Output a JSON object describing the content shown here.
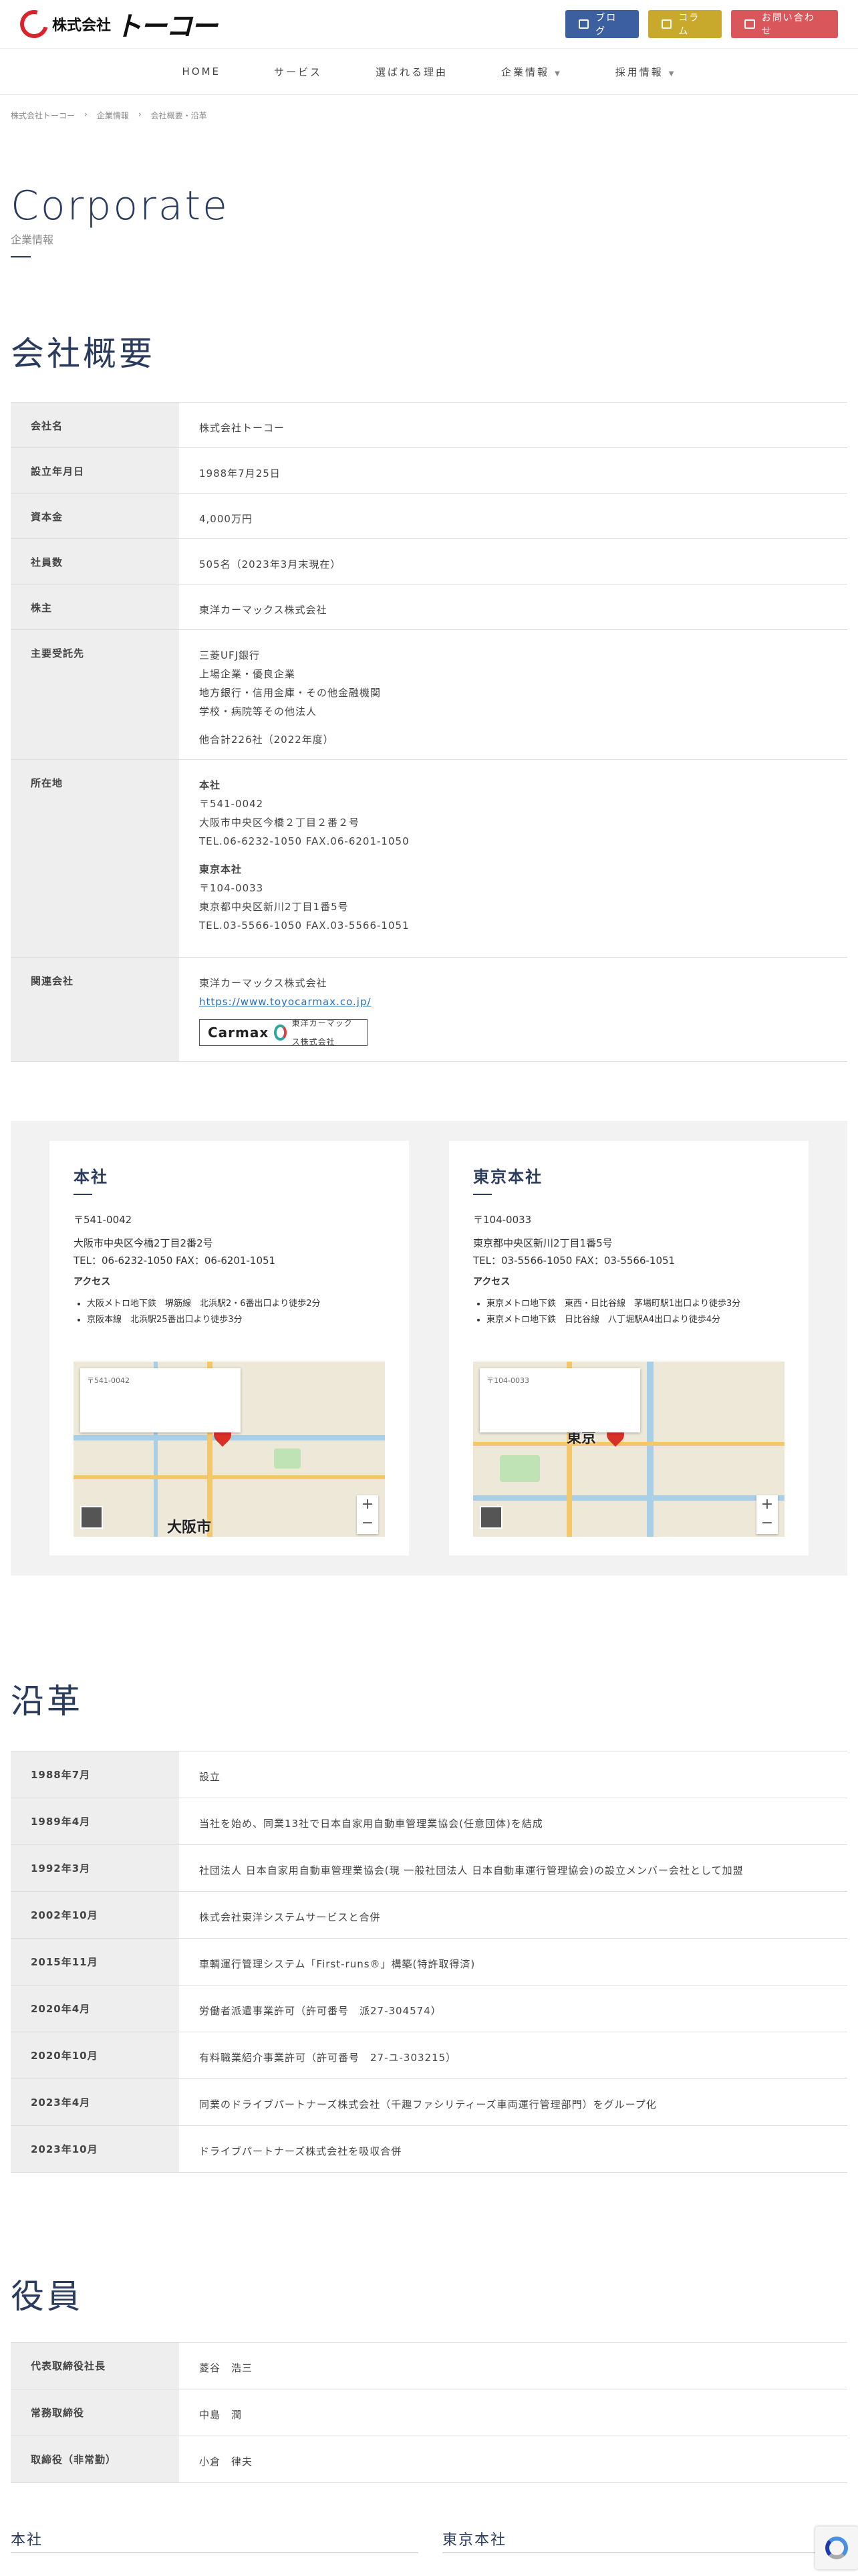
{
  "header": {
    "logo_small": "株式会社",
    "logo_big": "トーコー",
    "btn_blog": "ブログ",
    "btn_column": "コラム",
    "btn_contact": "お問い合わせ"
  },
  "nav": [
    "HOME",
    "サービス",
    "選ばれる理由",
    "企業情報",
    "採用情報"
  ],
  "breadcrumb": [
    "株式会社トーコー",
    "企業情報",
    "会社概要・沿革"
  ],
  "hero": {
    "en": "Corporate",
    "jp": "企業情報"
  },
  "overview": {
    "title": "会社概要",
    "rows": [
      {
        "th": "会社名",
        "td": [
          "株式会社トーコー"
        ]
      },
      {
        "th": "設立年月日",
        "td": [
          "1988年7月25日"
        ]
      },
      {
        "th": "資本金",
        "td": [
          "4,000万円"
        ]
      },
      {
        "th": "社員数",
        "td": [
          "505名（2023年3月末現在）"
        ]
      },
      {
        "th": "株主",
        "td": [
          "東洋カーマックス株式会社"
        ]
      },
      {
        "th": "主要受託先",
        "td": [
          "三菱UFJ銀行",
          "上場企業・優良企業",
          "地方銀行・信用金庫・その他金融機関",
          "学校・病院等その他法人",
          "",
          "他合計226社（2022年度）"
        ]
      },
      {
        "th": "所在地",
        "td": [
          "本社",
          "〒541-0042",
          "大阪市中央区今橋２丁目２番２号",
          "TEL.06-6232-1050 FAX.06-6201-1050",
          "",
          "東京本社",
          "〒104-0033",
          "東京都中央区新川2丁目1番5号",
          "TEL.03-5566-1050 FAX.03-5566-1051"
        ]
      },
      {
        "th": "関連会社",
        "td": [
          "東洋カーマックス株式会社",
          "https://www.toyocarmax.co.jp/"
        ]
      }
    ],
    "banner_logo": "Carmax",
    "banner_text": "東洋カーマックス株式会社"
  },
  "offices": [
    {
      "title": "本社",
      "zip": "〒541-0042",
      "addr": "大阪市中央区今橋2丁目2番2号",
      "tel": "TEL：06-6232-1050 FAX：06-6201-1051",
      "access_label": "アクセス",
      "access": [
        "大阪メトロ地下鉄　堺筋線　北浜駅2・6番出口より徒歩2分",
        "京阪本線　北浜駅25番出口より徒歩3分"
      ],
      "map_city": "大阪市",
      "map_zip": "〒541-0042"
    },
    {
      "title": "東京本社",
      "zip": "〒104-0033",
      "addr": "東京都中央区新川2丁目1番5号",
      "tel": "TEL：03-5566-1050 FAX：03-5566-1051",
      "access_label": "アクセス",
      "access": [
        "東京メトロ地下鉄　東西・日比谷線　茅場町駅1出口より徒歩3分",
        "東京メトロ地下鉄　日比谷線　八丁堀駅A4出口より徒歩4分"
      ],
      "map_city": "東京",
      "map_zip": "〒104-0033"
    }
  ],
  "history": {
    "title": "沿革",
    "rows": [
      {
        "th": "1988年7月",
        "td": "設立"
      },
      {
        "th": "1989年4月",
        "td": "当社を始め、同業13社で日本自家用自動車管理業協会(任意団体)を結成"
      },
      {
        "th": "1992年3月",
        "td": "社団法人 日本自家用自動車管理業協会(現 一般社団法人 日本自動車運行管理協会)の設立メンバー会社として加盟"
      },
      {
        "th": "2002年10月",
        "td": "株式会社東洋システムサービスと合併"
      },
      {
        "th": "2015年11月",
        "td": "車輌運行管理システム「First-runs®」構築(特許取得済)"
      },
      {
        "th": "2020年4月",
        "td": "労働者派遣事業許可（許可番号　派27-304574）"
      },
      {
        "th": "2020年10月",
        "td": "有料職業紹介事業許可（許可番号　27-ユ-303215）"
      },
      {
        "th": "2023年4月",
        "td": "同業のドライブパートナーズ株式会社（千趣ファシリティーズ車両運行管理部門）をグループ化"
      },
      {
        "th": "2023年10月",
        "td": "ドライブパートナーズ株式会社を吸収合併"
      }
    ]
  },
  "officers": {
    "title": "役員",
    "rows": [
      {
        "th": "代表取締役社長",
        "td": "菱谷　浩三"
      },
      {
        "th": "常務取締役",
        "td": "中島　潤"
      },
      {
        "th": "取締役（非常勤）",
        "td": "小倉　律夫"
      }
    ]
  },
  "bottom": {
    "left": "本社",
    "right": "東京本社"
  }
}
